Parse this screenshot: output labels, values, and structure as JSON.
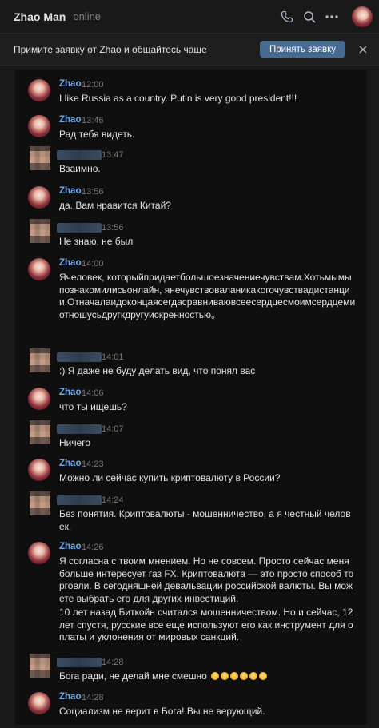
{
  "header": {
    "name": "Zhao Man",
    "status": "online",
    "icons": [
      "phone-icon",
      "search-icon",
      "more-icon"
    ]
  },
  "banner": {
    "text": "Примите заявку от Zhao и общайтесь чаще",
    "accept": "Принять заявку"
  },
  "messages": [
    {
      "author": "Zhao",
      "time": "12:00",
      "text": "I like Russia as a country. Putin is very good president!!!"
    },
    {
      "author": "Zhao",
      "time": "13:46",
      "text": "Рад тебя видеть."
    },
    {
      "author": "",
      "time": "13:47",
      "text": "Взаимно."
    },
    {
      "author": "Zhao",
      "time": "13:56",
      "text": "да. Вам нравится Китай?"
    },
    {
      "author": "",
      "time": "13:56",
      "text": "Не знаю, не был"
    },
    {
      "author": "Zhao",
      "time": "14:00",
      "text": "Ячеловек, которыйпридаетбольшоезначениечувствам.Хотьмымыпознакомилисьонлайн, янечувствоваланикакогочувствадистанции.Отначалаидоконцаясегдасравниваювсеесердцесмоимсердцемиотношусьдругкдругуискренностью。"
    },
    {
      "author": "",
      "time": "14:01",
      "text": ":) Я даже не буду делать вид, что понял вас"
    },
    {
      "author": "Zhao",
      "time": "14:06",
      "text": "что ты ищешь?"
    },
    {
      "author": "",
      "time": "14:07",
      "text": "Ничего"
    },
    {
      "author": "Zhao",
      "time": "14:23",
      "text": "Можно ли сейчас купить криптовалюту в России?"
    },
    {
      "author": "",
      "time": "14:24",
      "text": "Без понятия. Криптовалюты - мошенничество, а я честный человек."
    },
    {
      "author": "Zhao",
      "time": "14:26",
      "text": "Я согласна с твоим мнением. Но не совсем. Просто сейчас меня больше интересует газ FX. Криптовалюта — это просто способ торговли. В сегодняшней девальвации российской валюты. Вы можете выбрать его для других инвестиций.",
      "text2": "10 лет назад Биткойн считался мошенничеством. Но и сейчас, 12 лет спустя, русские все еще используют его как инструмент для оплаты и уклонения от мировых санкций."
    },
    {
      "author": "",
      "time": "14:28",
      "text": "Бога ради, не делай мне смешно",
      "emoji_count": 6
    },
    {
      "author": "Zhao",
      "time": "14:28",
      "text": "Социализм не верит в Бога! Вы не верующий."
    }
  ]
}
